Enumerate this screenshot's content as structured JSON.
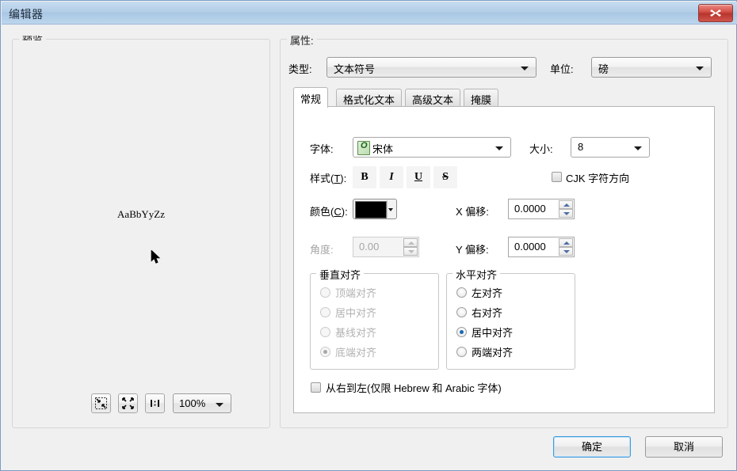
{
  "window": {
    "title": "编辑器",
    "close_icon": "close-x-icon"
  },
  "preview": {
    "group_label": "预览",
    "sample_text": "AaBbYyZz",
    "toolbar": {
      "zoom_in_selection_icon": "zoom-to-selection-icon",
      "zoom_extent_icon": "zoom-to-extent-icon",
      "one_to_one_icon": "one-to-one-icon",
      "zoom_value": "100%"
    }
  },
  "properties": {
    "group_label": "属性:",
    "type": {
      "label": "类型:",
      "value": "文本符号"
    },
    "unit": {
      "label": "单位:",
      "value": "磅"
    },
    "tabs": [
      {
        "label": "常规",
        "active": true
      },
      {
        "label": "格式化文本",
        "active": false
      },
      {
        "label": "高级文本",
        "active": false
      },
      {
        "label": "掩膜",
        "active": false
      }
    ],
    "general": {
      "font": {
        "label": "字体:",
        "value": "宋体",
        "icon": "opentype-font-icon",
        "icon_letter": "O"
      },
      "size": {
        "label": "大小:",
        "value": "8"
      },
      "style": {
        "label_prefix": "样式(",
        "label_key": "T",
        "label_suffix": "):",
        "buttons": [
          {
            "name": "bold",
            "glyph": "B"
          },
          {
            "name": "italic",
            "glyph": "I"
          },
          {
            "name": "underline",
            "glyph": "U"
          },
          {
            "name": "strikethrough",
            "glyph": "S"
          }
        ]
      },
      "cjk": {
        "label": "CJK 字符方向",
        "checked": false
      },
      "color": {
        "label_prefix": "颜色(",
        "label_key": "C",
        "label_suffix": "):",
        "value": "#000000"
      },
      "angle": {
        "label": "角度:",
        "value": "0.00",
        "enabled": false
      },
      "x_offset": {
        "label": "X 偏移:",
        "value": "0.0000"
      },
      "y_offset": {
        "label": "Y 偏移:",
        "value": "0.0000"
      },
      "vertical_align": {
        "legend": "垂直对齐",
        "enabled": false,
        "options": [
          {
            "label": "顶端对齐",
            "selected": false
          },
          {
            "label": "居中对齐",
            "selected": false
          },
          {
            "label": "基线对齐",
            "selected": false
          },
          {
            "label": "底端对齐",
            "selected": true
          }
        ]
      },
      "horizontal_align": {
        "legend": "水平对齐",
        "enabled": true,
        "options": [
          {
            "label": "左对齐",
            "selected": false
          },
          {
            "label": "右对齐",
            "selected": false
          },
          {
            "label": "居中对齐",
            "selected": true
          },
          {
            "label": "两端对齐",
            "selected": false
          }
        ]
      },
      "rtl": {
        "label": "从右到左(仅限 Hebrew 和 Arabic 字体)",
        "checked": false
      }
    }
  },
  "footer": {
    "ok_label": "确定",
    "cancel_label": "取消"
  }
}
